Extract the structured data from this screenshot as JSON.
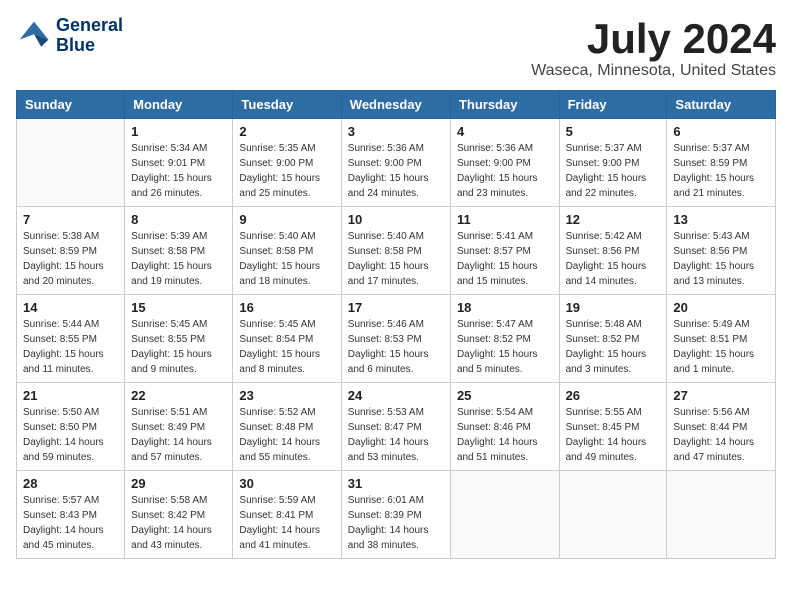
{
  "logo": {
    "line1": "General",
    "line2": "Blue"
  },
  "title": "July 2024",
  "location": "Waseca, Minnesota, United States",
  "days_of_week": [
    "Sunday",
    "Monday",
    "Tuesday",
    "Wednesday",
    "Thursday",
    "Friday",
    "Saturday"
  ],
  "weeks": [
    [
      {
        "day": "",
        "info": ""
      },
      {
        "day": "1",
        "info": "Sunrise: 5:34 AM\nSunset: 9:01 PM\nDaylight: 15 hours\nand 26 minutes."
      },
      {
        "day": "2",
        "info": "Sunrise: 5:35 AM\nSunset: 9:00 PM\nDaylight: 15 hours\nand 25 minutes."
      },
      {
        "day": "3",
        "info": "Sunrise: 5:36 AM\nSunset: 9:00 PM\nDaylight: 15 hours\nand 24 minutes."
      },
      {
        "day": "4",
        "info": "Sunrise: 5:36 AM\nSunset: 9:00 PM\nDaylight: 15 hours\nand 23 minutes."
      },
      {
        "day": "5",
        "info": "Sunrise: 5:37 AM\nSunset: 9:00 PM\nDaylight: 15 hours\nand 22 minutes."
      },
      {
        "day": "6",
        "info": "Sunrise: 5:37 AM\nSunset: 8:59 PM\nDaylight: 15 hours\nand 21 minutes."
      }
    ],
    [
      {
        "day": "7",
        "info": "Sunrise: 5:38 AM\nSunset: 8:59 PM\nDaylight: 15 hours\nand 20 minutes."
      },
      {
        "day": "8",
        "info": "Sunrise: 5:39 AM\nSunset: 8:58 PM\nDaylight: 15 hours\nand 19 minutes."
      },
      {
        "day": "9",
        "info": "Sunrise: 5:40 AM\nSunset: 8:58 PM\nDaylight: 15 hours\nand 18 minutes."
      },
      {
        "day": "10",
        "info": "Sunrise: 5:40 AM\nSunset: 8:58 PM\nDaylight: 15 hours\nand 17 minutes."
      },
      {
        "day": "11",
        "info": "Sunrise: 5:41 AM\nSunset: 8:57 PM\nDaylight: 15 hours\nand 15 minutes."
      },
      {
        "day": "12",
        "info": "Sunrise: 5:42 AM\nSunset: 8:56 PM\nDaylight: 15 hours\nand 14 minutes."
      },
      {
        "day": "13",
        "info": "Sunrise: 5:43 AM\nSunset: 8:56 PM\nDaylight: 15 hours\nand 13 minutes."
      }
    ],
    [
      {
        "day": "14",
        "info": "Sunrise: 5:44 AM\nSunset: 8:55 PM\nDaylight: 15 hours\nand 11 minutes."
      },
      {
        "day": "15",
        "info": "Sunrise: 5:45 AM\nSunset: 8:55 PM\nDaylight: 15 hours\nand 9 minutes."
      },
      {
        "day": "16",
        "info": "Sunrise: 5:45 AM\nSunset: 8:54 PM\nDaylight: 15 hours\nand 8 minutes."
      },
      {
        "day": "17",
        "info": "Sunrise: 5:46 AM\nSunset: 8:53 PM\nDaylight: 15 hours\nand 6 minutes."
      },
      {
        "day": "18",
        "info": "Sunrise: 5:47 AM\nSunset: 8:52 PM\nDaylight: 15 hours\nand 5 minutes."
      },
      {
        "day": "19",
        "info": "Sunrise: 5:48 AM\nSunset: 8:52 PM\nDaylight: 15 hours\nand 3 minutes."
      },
      {
        "day": "20",
        "info": "Sunrise: 5:49 AM\nSunset: 8:51 PM\nDaylight: 15 hours\nand 1 minute."
      }
    ],
    [
      {
        "day": "21",
        "info": "Sunrise: 5:50 AM\nSunset: 8:50 PM\nDaylight: 14 hours\nand 59 minutes."
      },
      {
        "day": "22",
        "info": "Sunrise: 5:51 AM\nSunset: 8:49 PM\nDaylight: 14 hours\nand 57 minutes."
      },
      {
        "day": "23",
        "info": "Sunrise: 5:52 AM\nSunset: 8:48 PM\nDaylight: 14 hours\nand 55 minutes."
      },
      {
        "day": "24",
        "info": "Sunrise: 5:53 AM\nSunset: 8:47 PM\nDaylight: 14 hours\nand 53 minutes."
      },
      {
        "day": "25",
        "info": "Sunrise: 5:54 AM\nSunset: 8:46 PM\nDaylight: 14 hours\nand 51 minutes."
      },
      {
        "day": "26",
        "info": "Sunrise: 5:55 AM\nSunset: 8:45 PM\nDaylight: 14 hours\nand 49 minutes."
      },
      {
        "day": "27",
        "info": "Sunrise: 5:56 AM\nSunset: 8:44 PM\nDaylight: 14 hours\nand 47 minutes."
      }
    ],
    [
      {
        "day": "28",
        "info": "Sunrise: 5:57 AM\nSunset: 8:43 PM\nDaylight: 14 hours\nand 45 minutes."
      },
      {
        "day": "29",
        "info": "Sunrise: 5:58 AM\nSunset: 8:42 PM\nDaylight: 14 hours\nand 43 minutes."
      },
      {
        "day": "30",
        "info": "Sunrise: 5:59 AM\nSunset: 8:41 PM\nDaylight: 14 hours\nand 41 minutes."
      },
      {
        "day": "31",
        "info": "Sunrise: 6:01 AM\nSunset: 8:39 PM\nDaylight: 14 hours\nand 38 minutes."
      },
      {
        "day": "",
        "info": ""
      },
      {
        "day": "",
        "info": ""
      },
      {
        "day": "",
        "info": ""
      }
    ]
  ]
}
